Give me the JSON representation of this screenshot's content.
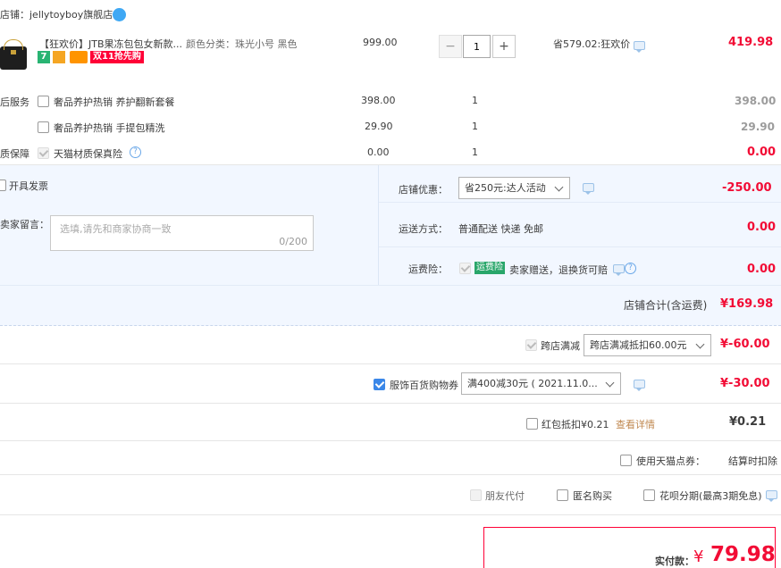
{
  "shop": {
    "label": "店铺：",
    "name": "jellytoyboy旗舰店"
  },
  "item": {
    "title": "【狂欢价】JTB果冻包包女新款...",
    "attr_label": "颜色分类：",
    "attr_value": "珠光小号 黑色",
    "price": "999.00",
    "qty": "1",
    "promo": "省579.02:狂欢价",
    "total": "419.98",
    "badges": {
      "b1": "7",
      "sale": "双11抢先购"
    }
  },
  "services": {
    "after_label": "后服务",
    "quality_label": "质保障",
    "rows": [
      {
        "name": "奢品养护热销 养护翻新套餐",
        "price": "398.00",
        "qty": "1",
        "total": "398.00"
      },
      {
        "name": "奢品养护热销 手提包精洗",
        "price": "29.90",
        "qty": "1",
        "total": "29.90"
      },
      {
        "name": "天猫材质保真险",
        "price": "0.00",
        "qty": "1",
        "total": "0.00"
      }
    ]
  },
  "invoice": {
    "label": "开具发票"
  },
  "message": {
    "label": "卖家留言：",
    "placeholder": "选填,请先和商家协商一致",
    "count": "0/200"
  },
  "shop_discount": {
    "label": "店铺优惠：",
    "value": "省250元:达人活动",
    "amount": "-250.00"
  },
  "shipping": {
    "label": "运送方式：",
    "value": "普通配送 快递 免邮",
    "amount": "0.00"
  },
  "freight_insurance": {
    "label": "运费险：",
    "tag": "运费险",
    "desc": "卖家赠送，退换货可赔",
    "amount": "0.00"
  },
  "shop_total": {
    "label": "店铺合计(含运费)",
    "amount": "¥169.98"
  },
  "cross_store": {
    "label": "跨店满减",
    "value": "跨店满减抵扣60.00元",
    "amount": "¥-60.00"
  },
  "coupon": {
    "label": "服饰百货购物券",
    "value": "满400减30元 ( 2021.11.0...",
    "amount": "¥-30.00"
  },
  "red_packet": {
    "label": "红包抵扣¥0.21",
    "link": "查看详情",
    "amount": "¥0.21"
  },
  "tmall_points": {
    "label": "使用天猫点券：",
    "value": "结算时扣除"
  },
  "options": {
    "friend_pay": "朋友代付",
    "anonymous": "匿名购买",
    "huabei": "花呗分期(最高3期免息)"
  },
  "final": {
    "label": "实付款：",
    "currency": "¥",
    "amount": "79.98"
  }
}
